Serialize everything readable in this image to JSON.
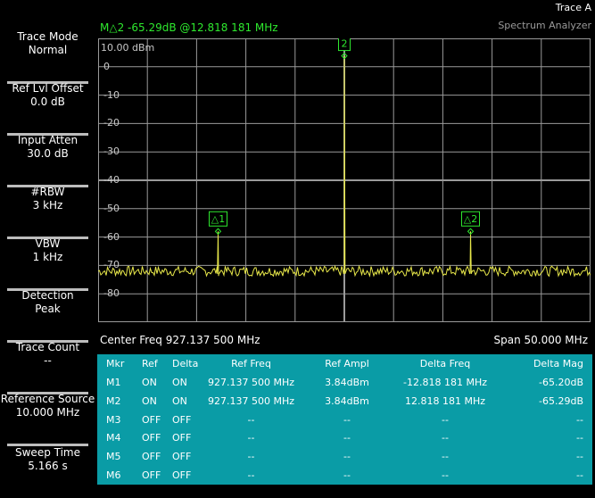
{
  "header": {
    "window_label": "Trace A",
    "app_title": "Spectrum Analyzer",
    "marker_readout": "M△2 -65.29dB @12.818 181 MHz"
  },
  "sidebar": {
    "items": [
      {
        "label": "Trace Mode",
        "value": "Normal"
      },
      {
        "label": "Ref Lvl Offset",
        "value": "0.0 dB"
      },
      {
        "label": "Input Atten",
        "value": "30.0 dB"
      },
      {
        "label": "#RBW",
        "value": "3 kHz"
      },
      {
        "label": "VBW",
        "value": "1 kHz"
      },
      {
        "label": "Detection",
        "value": "Peak"
      },
      {
        "label": "Trace Count",
        "value": "--"
      },
      {
        "label": "Reference Source",
        "value": "10.000 MHz"
      },
      {
        "label": "Sweep Time",
        "value": "5.166 s"
      }
    ]
  },
  "plot": {
    "ref_level": "10.00 dBm",
    "y_labels": [
      "0",
      "-10",
      "-20",
      "-30",
      "-40",
      "-50",
      "-60",
      "-70",
      "-80"
    ],
    "center_freq": "Center Freq 927.137 500 MHz",
    "span": "Span 50.000 MHz",
    "marker_labels": [
      "△1",
      "2",
      "△2"
    ],
    "colors": {
      "trace": "#e8e84a",
      "marker": "#2ee82e",
      "grid": "#9a9a9a",
      "table": "#0a9ca6"
    }
  },
  "chart_data": {
    "type": "line",
    "title": "",
    "xlabel": "Center Freq 927.137 500 MHz",
    "ylabel": "",
    "x_center_mhz": 927.1375,
    "span_mhz": 50,
    "ylim": [
      -90,
      10
    ],
    "noise_floor_dbm": -72,
    "peaks": [
      {
        "name": "△1",
        "offset_mhz": -12.818,
        "level_dbm": -58
      },
      {
        "name": "2",
        "offset_mhz": 0,
        "level_dbm": 3.84
      },
      {
        "name": "△2",
        "offset_mhz": 12.818,
        "level_dbm": -58
      }
    ],
    "grid": true
  },
  "marker_table": {
    "headers": [
      "Mkr",
      "Ref",
      "Delta",
      "Ref Freq",
      "Ref Ampl",
      "Delta Freq",
      "Delta Mag"
    ],
    "rows": [
      [
        "M1",
        "ON",
        "ON",
        "927.137 500 MHz",
        "3.84dBm",
        "-12.818 181 MHz",
        "-65.20dB"
      ],
      [
        "M2",
        "ON",
        "ON",
        "927.137 500 MHz",
        "3.84dBm",
        "12.818 181 MHz",
        "-65.29dB"
      ],
      [
        "M3",
        "OFF",
        "OFF",
        "--",
        "--",
        "--",
        "--"
      ],
      [
        "M4",
        "OFF",
        "OFF",
        "--",
        "--",
        "--",
        "--"
      ],
      [
        "M5",
        "OFF",
        "OFF",
        "--",
        "--",
        "--",
        "--"
      ],
      [
        "M6",
        "OFF",
        "OFF",
        "--",
        "--",
        "--",
        "--"
      ]
    ]
  }
}
